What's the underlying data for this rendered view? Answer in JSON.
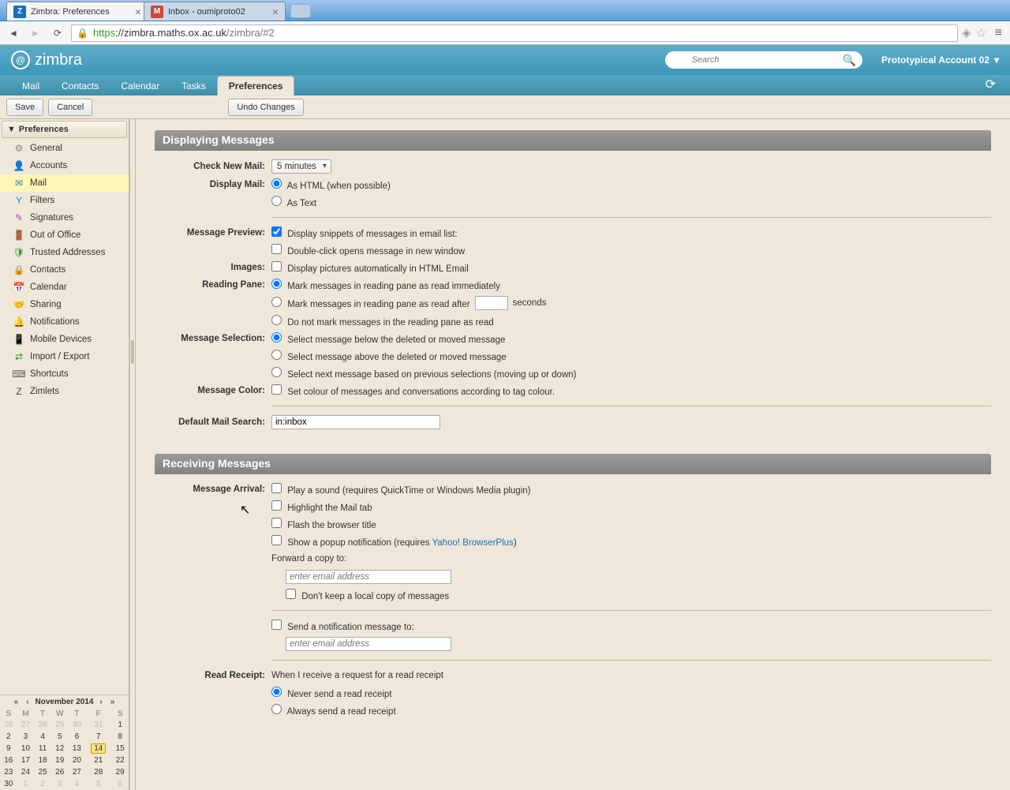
{
  "browser": {
    "tab1": {
      "title": "Zimbra: Preferences",
      "faviconLetter": "Z",
      "faviconBg": "#1a6fbf"
    },
    "tab2": {
      "title": "Inbox - oumiproto02",
      "faviconLetter": "M",
      "faviconBg": "#d14836"
    },
    "url_proto": "https",
    "url_host": "://zimbra.maths.ox.ac.uk",
    "url_path": "/zimbra/#2"
  },
  "header": {
    "logo": "zimbra",
    "search_placeholder": "Search",
    "account": "Prototypical Account 02"
  },
  "tabs": {
    "mail": "Mail",
    "contacts": "Contacts",
    "calendar": "Calendar",
    "tasks": "Tasks",
    "preferences": "Preferences"
  },
  "toolbar": {
    "save": "Save",
    "cancel": "Cancel",
    "undo": "Undo Changes"
  },
  "sidebar": {
    "header": "Preferences",
    "items": [
      {
        "label": "General",
        "icon": "⚙",
        "color": "#888"
      },
      {
        "label": "Accounts",
        "icon": "👤",
        "color": "#d08a2e"
      },
      {
        "label": "Mail",
        "icon": "✉",
        "color": "#3a7fc4",
        "selected": true
      },
      {
        "label": "Filters",
        "icon": "Y",
        "color": "#3a7fc4"
      },
      {
        "label": "Signatures",
        "icon": "✎",
        "color": "#b14ab1"
      },
      {
        "label": "Out of Office",
        "icon": "🚪",
        "color": "#b86b2c"
      },
      {
        "label": "Trusted Addresses",
        "icon": "🛡",
        "color": "#2e9a2e"
      },
      {
        "label": "Contacts",
        "icon": "🔒",
        "color": "#3a7fc4"
      },
      {
        "label": "Calendar",
        "icon": "📅",
        "color": "#3a7fc4"
      },
      {
        "label": "Sharing",
        "icon": "🤝",
        "color": "#a06838"
      },
      {
        "label": "Notifications",
        "icon": "🔔",
        "color": "#d6a100"
      },
      {
        "label": "Mobile Devices",
        "icon": "📱",
        "color": "#3a7fc4"
      },
      {
        "label": "Import / Export",
        "icon": "⇄",
        "color": "#2e9a2e"
      },
      {
        "label": "Shortcuts",
        "icon": "⌨",
        "color": "#666"
      },
      {
        "label": "Zimlets",
        "icon": "Z",
        "color": "#444"
      }
    ]
  },
  "calendar": {
    "title": "November 2014",
    "dow": [
      "S",
      "M",
      "T",
      "W",
      "T",
      "F",
      "S"
    ],
    "weeks": [
      [
        {
          "d": "26",
          "o": 1
        },
        {
          "d": "27",
          "o": 1
        },
        {
          "d": "28",
          "o": 1
        },
        {
          "d": "29",
          "o": 1
        },
        {
          "d": "30",
          "o": 1
        },
        {
          "d": "31",
          "o": 1
        },
        {
          "d": "1"
        }
      ],
      [
        {
          "d": "2"
        },
        {
          "d": "3"
        },
        {
          "d": "4"
        },
        {
          "d": "5"
        },
        {
          "d": "6"
        },
        {
          "d": "7"
        },
        {
          "d": "8"
        }
      ],
      [
        {
          "d": "9"
        },
        {
          "d": "10"
        },
        {
          "d": "11"
        },
        {
          "d": "12"
        },
        {
          "d": "13"
        },
        {
          "d": "14",
          "t": 1
        },
        {
          "d": "15"
        }
      ],
      [
        {
          "d": "16"
        },
        {
          "d": "17"
        },
        {
          "d": "18"
        },
        {
          "d": "19"
        },
        {
          "d": "20"
        },
        {
          "d": "21"
        },
        {
          "d": "22"
        }
      ],
      [
        {
          "d": "23"
        },
        {
          "d": "24"
        },
        {
          "d": "25"
        },
        {
          "d": "26"
        },
        {
          "d": "27"
        },
        {
          "d": "28"
        },
        {
          "d": "29"
        }
      ],
      [
        {
          "d": "30"
        },
        {
          "d": "1",
          "o": 1
        },
        {
          "d": "2",
          "o": 1
        },
        {
          "d": "3",
          "o": 1
        },
        {
          "d": "4",
          "o": 1
        },
        {
          "d": "5",
          "o": 1
        },
        {
          "d": "6",
          "o": 1
        }
      ]
    ]
  },
  "sections": {
    "displaying": {
      "title": "Displaying Messages",
      "checkNewMail_label": "Check New Mail:",
      "checkNewMail_value": "5 minutes",
      "displayMail_label": "Display Mail:",
      "displayMail_opt1": "As HTML (when possible)",
      "displayMail_opt2": "As Text",
      "messagePreview_label": "Message Preview:",
      "messagePreview_opt1": "Display snippets of messages in email list:",
      "messagePreview_opt2": "Double-click opens message in new window",
      "images_label": "Images:",
      "images_opt": "Display pictures automatically in HTML Email",
      "readingPane_label": "Reading Pane:",
      "readingPane_opt1": "Mark messages in reading pane as read immediately",
      "readingPane_opt2a": "Mark messages in reading pane as read after",
      "readingPane_opt2b": "seconds",
      "readingPane_opt3": "Do not mark messages in the reading pane as read",
      "messageSelection_label": "Message Selection:",
      "messageSelection_opt1": "Select message below the deleted or moved message",
      "messageSelection_opt2": "Select message above the deleted or moved message",
      "messageSelection_opt3": "Select next message based on previous selections (moving up or down)",
      "messageColor_label": "Message Color:",
      "messageColor_opt": "Set colour of messages and conversations according to tag colour.",
      "defaultSearch_label": "Default Mail Search:",
      "defaultSearch_value": "in:inbox"
    },
    "receiving": {
      "title": "Receiving Messages",
      "messageArrival_label": "Message Arrival:",
      "arr_opt1": "Play a sound (requires QuickTime or Windows Media plugin)",
      "arr_opt2": "Highlight the Mail tab",
      "arr_opt3": "Flash the browser title",
      "arr_opt4a": "Show a popup notification (requires ",
      "arr_opt4b": "Yahoo! BrowserPlus",
      "arr_opt4c": ")",
      "forward_label": "Forward a copy to:",
      "forward_placeholder": "enter email address",
      "dontKeep": "Don't keep a local copy of messages",
      "sendNotif": "Send a notification message to:",
      "notif_placeholder": "enter email address",
      "readReceipt_label": "Read Receipt:",
      "readReceipt_desc": "When I receive a request for a read receipt",
      "rr_opt1": "Never send a read receipt",
      "rr_opt2": "Always send a read receipt"
    }
  }
}
